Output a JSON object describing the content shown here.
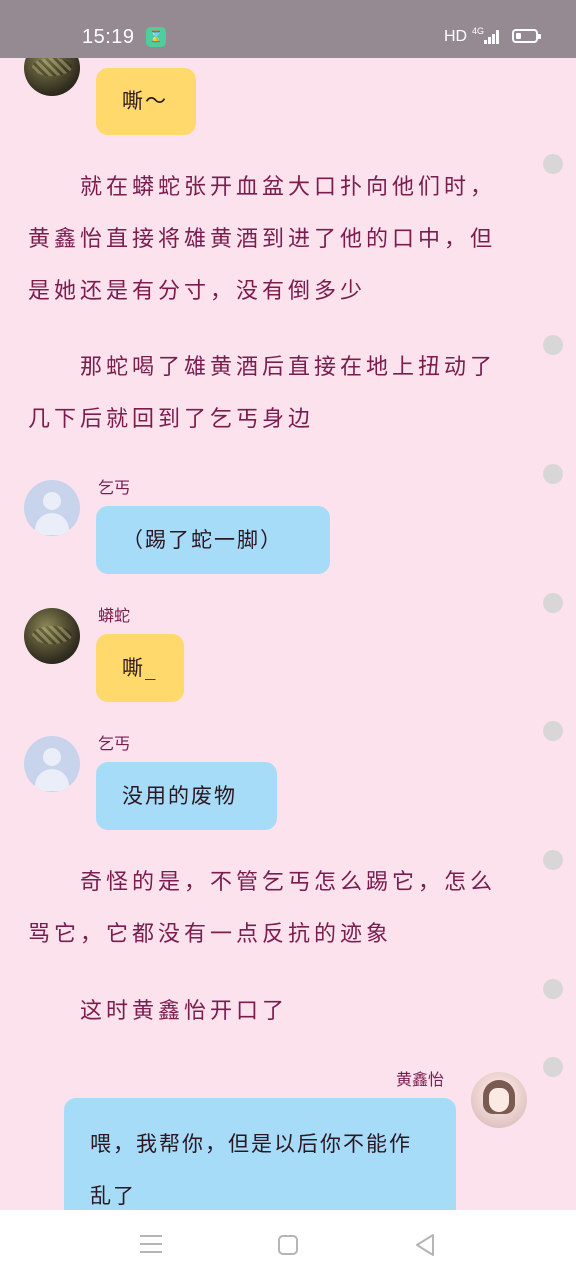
{
  "status_bar": {
    "time": "15:19",
    "app_icon_glyph": "⌛",
    "hd": "HD",
    "network": "4G",
    "battery_icon": "battery-icon"
  },
  "chat": {
    "top_bubble": {
      "text": "嘶～"
    },
    "narration_1": "就在蟒蛇张开血盆大口扑向他们时，黄鑫怡直接将雄黄酒到进了他的口中，但是她还是有分寸，没有倒多少",
    "narration_2": "那蛇喝了雄黄酒后直接在地上扭动了几下后就回到了乞丐身边",
    "msg_beggar_1": {
      "name": "乞丐",
      "text": "（踢了蛇一脚）"
    },
    "msg_snake": {
      "name": "蟒蛇",
      "text": "嘶_"
    },
    "msg_beggar_2": {
      "name": "乞丐",
      "text": "没用的废物"
    },
    "narration_3": "奇怪的是，不管乞丐怎么踢它，怎么骂它，它都没有一点反抗的迹象",
    "narration_4": "这时黄鑫怡开口了",
    "msg_huang": {
      "name": "黄鑫怡",
      "text": "喂，我帮你，但是以后你不能作乱了"
    }
  },
  "colors": {
    "background": "#fbe2ec",
    "narration_text": "#7a1c4e",
    "bubble_yellow": "#ffd96b",
    "bubble_blue": "#a7dcf8"
  },
  "nav_bar": {
    "icons": [
      "menu-icon",
      "home-icon",
      "back-icon"
    ]
  }
}
